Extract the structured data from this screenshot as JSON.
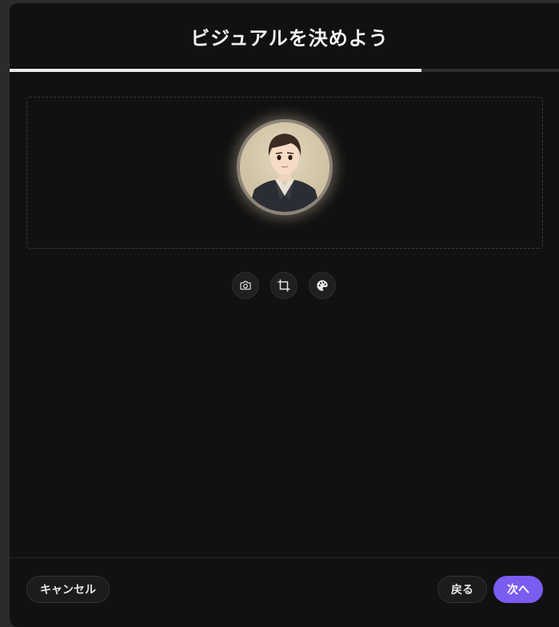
{
  "dialog": {
    "title": "ビジュアルを決めよう",
    "progress_fraction": 0.75
  },
  "avatar": {
    "icon": "avatar-portrait"
  },
  "tools": [
    {
      "name": "camera-icon",
      "label": "camera"
    },
    {
      "name": "crop-icon",
      "label": "crop"
    },
    {
      "name": "palette-icon",
      "label": "palette"
    }
  ],
  "footer": {
    "cancel_label": "キャンセル",
    "back_label": "戻る",
    "next_label": "次へ"
  },
  "colors": {
    "accent": "#7b5cf0",
    "background": "#111111",
    "progress": "#ececec"
  }
}
